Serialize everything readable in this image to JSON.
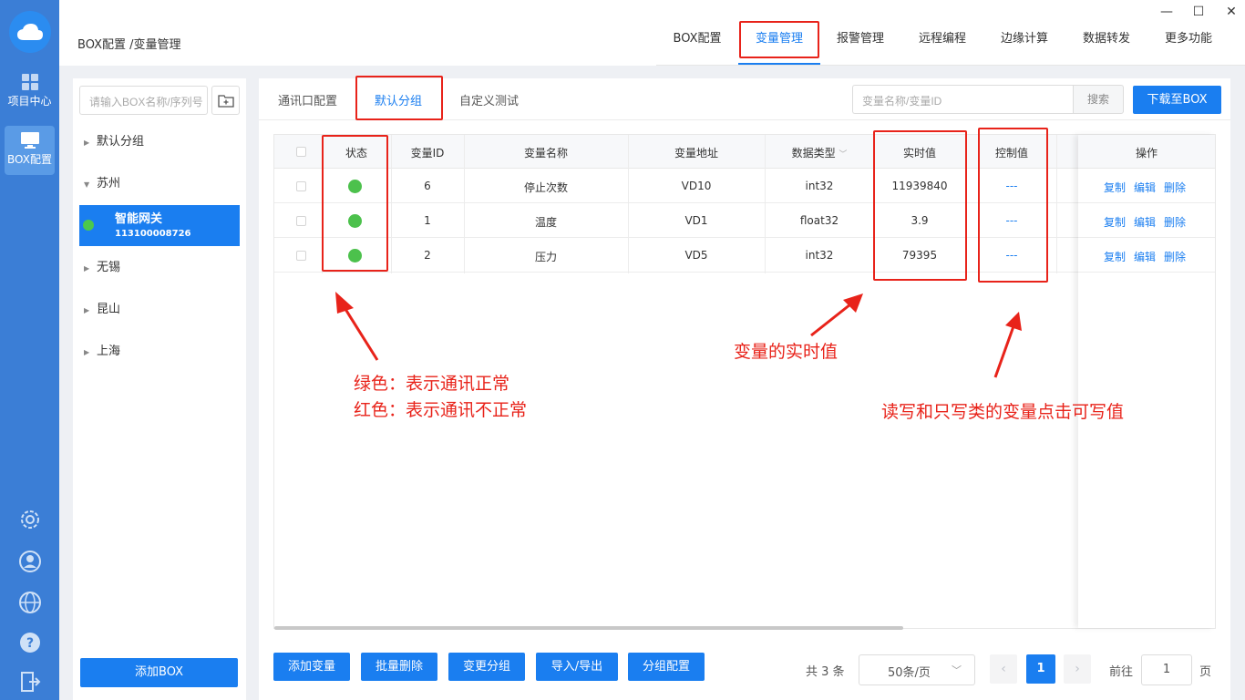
{
  "rail": {
    "items": [
      {
        "label": "项目中心",
        "icon": "grid-icon"
      },
      {
        "label": "BOX配置",
        "icon": "monitor-icon"
      }
    ],
    "tools": [
      "settings-icon",
      "user-icon",
      "globe-icon",
      "help-icon",
      "logout-icon"
    ]
  },
  "header": {
    "breadcrumb": "BOX配置 /变量管理",
    "tabs": [
      "BOX配置",
      "变量管理",
      "报警管理",
      "远程编程",
      "边缘计算",
      "数据转发",
      "更多功能"
    ],
    "active_tab": "变量管理"
  },
  "sidebar": {
    "search_placeholder": "请输入BOX名称/序列号",
    "groups": [
      "默认分组",
      "苏州",
      "无锡",
      "昆山",
      "上海"
    ],
    "device": {
      "name": "智能网关",
      "serial": "113100008726",
      "status_color": "#4cc94c"
    },
    "add_button": "添加BOX"
  },
  "main": {
    "subtabs": [
      "通讯口配置",
      "默认分组",
      "自定义测试"
    ],
    "active_subtab": "默认分组",
    "search_placeholder": "变量名称/变量ID",
    "search_button": "搜索",
    "download_button": "下载至BOX",
    "columns": [
      "状态",
      "变量ID",
      "变量名称",
      "变量地址",
      "数据类型",
      "实时值",
      "控制值",
      "操作"
    ],
    "rows": [
      {
        "id": "6",
        "name": "停止次数",
        "address": "VD10",
        "type": "int32",
        "value": "11939840",
        "control": "---"
      },
      {
        "id": "1",
        "name": "温度",
        "address": "VD1",
        "type": "float32",
        "value": "3.9",
        "control": "---"
      },
      {
        "id": "2",
        "name": "压力",
        "address": "VD5",
        "type": "int32",
        "value": "79395",
        "control": "---"
      }
    ],
    "row_actions": [
      "复制",
      "编辑",
      "删除"
    ],
    "bottom_buttons": [
      "添加变量",
      "批量删除",
      "变更分组",
      "导入/导出",
      "分组配置"
    ],
    "pagination": {
      "total": "共 3 条",
      "page_size": "50条/页",
      "current": "1",
      "goto_label": "前往",
      "goto_value": "1",
      "page_unit": "页"
    }
  },
  "annotations": {
    "status_note_1": "绿色：表示通讯正常",
    "status_note_2": "红色：表示通讯不正常",
    "value_note": "变量的实时值",
    "control_note": "读写和只写类的变量点击可写值",
    "color": "#e8231a"
  },
  "colors": {
    "primary": "#1a7ef0",
    "rail": "#3b7ed6",
    "ok": "#4cc14c"
  }
}
